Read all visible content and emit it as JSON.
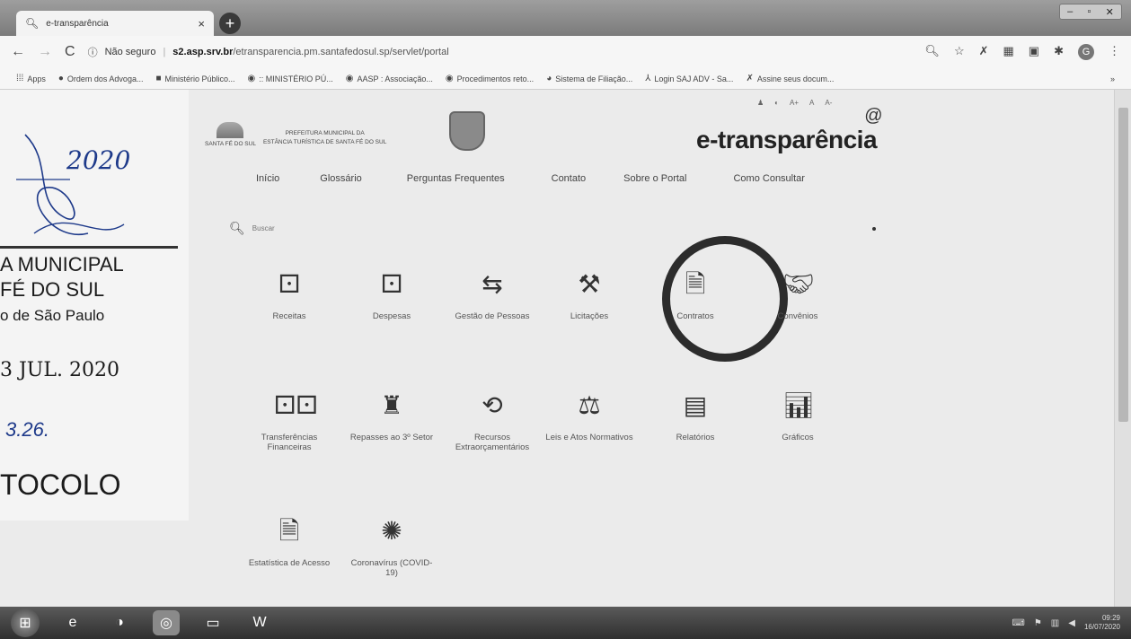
{
  "browser": {
    "tab_title": "e-transparência",
    "new_tab": "+",
    "close_tab": "×",
    "security": "Não seguro",
    "url_host": "s2.asp.srv.br",
    "url_path": "/etransparencia.pm.santafedosul.sp/servlet/portal",
    "bookmarks": [
      "Apps",
      "Ordem dos Advoga...",
      "Ministério Público...",
      ":: MINISTÉRIO PÚ...",
      "AASP : Associação...",
      "Procedimentos reto...",
      "Sistema de Filiação...",
      "Login SAJ ADV - Sa...",
      "Assine seus docum..."
    ]
  },
  "header": {
    "municipality_line1": "PREFEITURA MUNICIPAL DA",
    "municipality_line2": "ESTÂNCIA TURÍSTICA DE SANTA FÉ DO SUL",
    "logo_caption": "SANTA FÉ DO SUL",
    "site_title": "e-transparência",
    "site_title_mark": "@",
    "accessibility": [
      "A+",
      "A",
      "A-"
    ]
  },
  "nav": {
    "items": [
      "Início",
      "Glossário",
      "Perguntas Frequentes",
      "Contato",
      "Sobre o Portal",
      "Como Consultar"
    ]
  },
  "search": {
    "placeholder": "Buscar"
  },
  "tiles": [
    {
      "label": "Receitas",
      "icon": "receitas-icon"
    },
    {
      "label": "Despesas",
      "icon": "despesas-icon"
    },
    {
      "label": "Gestão de Pessoas",
      "icon": "gestao-pessoas-icon"
    },
    {
      "label": "Licitações",
      "icon": "gavel-icon"
    },
    {
      "label": "Contratos",
      "icon": "contract-document-icon"
    },
    {
      "label": "Convênios",
      "icon": "handshake-icon"
    },
    {
      "label": "Transferências Financeiras",
      "icon": "transferencias-icon"
    },
    {
      "label": "Repasses ao 3º Setor",
      "icon": "repasses-icon"
    },
    {
      "label": "Recursos Extraorçamentários",
      "icon": "recursos-icon"
    },
    {
      "label": "Leis e Atos Normativos",
      "icon": "scales-icon"
    },
    {
      "label": "Relatórios",
      "icon": "report-book-icon"
    },
    {
      "label": "Gráficos",
      "icon": "bar-chart-icon"
    },
    {
      "label": "Estatística de Acesso",
      "icon": "statistics-document-icon"
    },
    {
      "label": "Coronavírus (COVID-19)",
      "icon": "virus-icon"
    }
  ],
  "stamp": {
    "handwritten_year": "2020",
    "line1": "A MUNICIPAL",
    "line2": "FÉ DO SUL",
    "line3": "o de São Paulo",
    "date": "3 JUL. 2020",
    "handwritten_number": "3.26.",
    "protocol": "TOCOLO"
  },
  "taskbar": {
    "clock_time": "09:29",
    "clock_date": "16/07/2020"
  }
}
